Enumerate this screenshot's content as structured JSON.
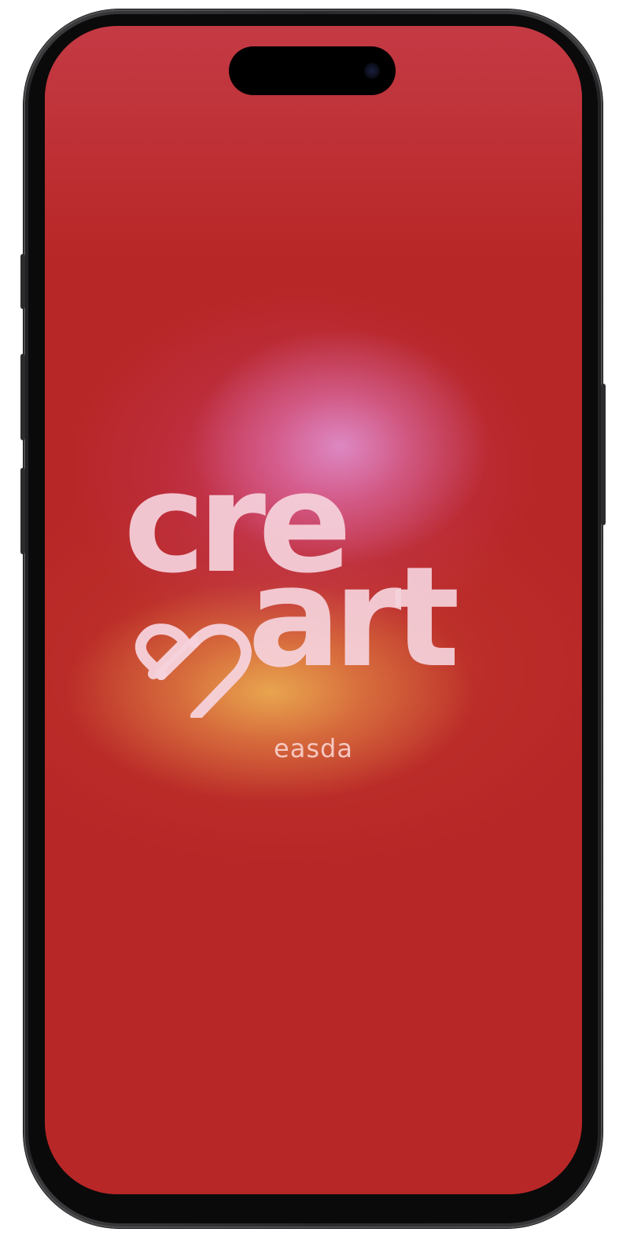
{
  "device": {
    "frame_color": "#2a2a2c",
    "screen_background": "#b82727"
  },
  "splash": {
    "logo": {
      "line1": "cre",
      "line2": "art",
      "mark_icon": "heart-outline-icon",
      "color": "#f5d2dc"
    },
    "tagline": "easda",
    "gradient_colors": {
      "base": "#b82727",
      "pink": "#de8cc8",
      "orange": "#eaaa50"
    }
  }
}
